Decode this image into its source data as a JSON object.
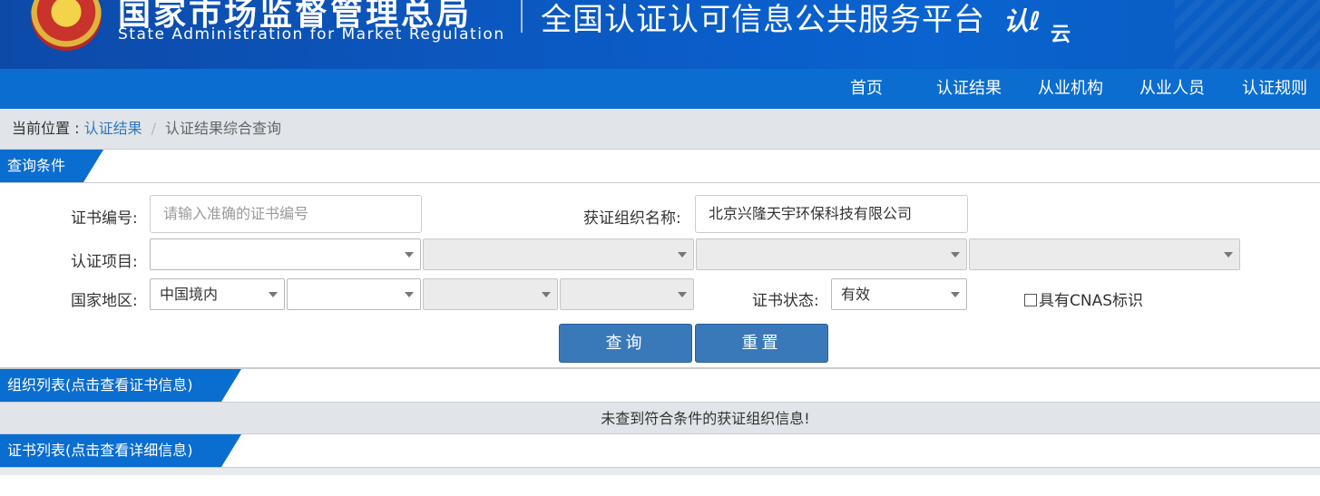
{
  "header": {
    "agency_cn": "国家市场监督管理总局",
    "agency_en": "State Administration  for  Market Regulation",
    "platform_title": "全国认证认可信息公共服务平台",
    "logo_text": "认",
    "logo_sub": "云"
  },
  "nav": {
    "items": [
      {
        "label": "首页"
      },
      {
        "label": "认证结果"
      },
      {
        "label": "从业机构"
      },
      {
        "label": "从业人员"
      },
      {
        "label": "认证规则"
      }
    ]
  },
  "breadcrumb": {
    "prefix": "当前位置 : ",
    "link": "认证结果",
    "separator": "/",
    "current": "认证结果综合查询"
  },
  "query": {
    "section_title": "查询条件",
    "cert_no_label": "证书编号:",
    "cert_no_placeholder": "请输入准确的证书编号",
    "org_name_label": "获证组织名称:",
    "org_name_value": "北京兴隆天宇环保科技有限公司",
    "cert_item_label": "认证项目:",
    "cert_item_values": [
      "",
      "",
      "",
      ""
    ],
    "region_label": "国家地区:",
    "region_values": [
      "中国境内",
      "",
      "",
      ""
    ],
    "status_label": "证书状态:",
    "status_value": "有效",
    "cnas_label": "具有CNAS标识",
    "cnas_checked": false,
    "search_button": "查询",
    "reset_button": "重置"
  },
  "org_list": {
    "section_title": "组织列表(点击查看证书信息)",
    "empty_message": "未查到符合条件的获证组织信息!"
  },
  "cert_list": {
    "section_title": "证书列表(点击查看详细信息)"
  },
  "colors": {
    "header_blue": "#0b5ac4",
    "nav_blue": "#0c6dd0",
    "button_blue": "#3979b9",
    "link_blue": "#3278c0"
  }
}
